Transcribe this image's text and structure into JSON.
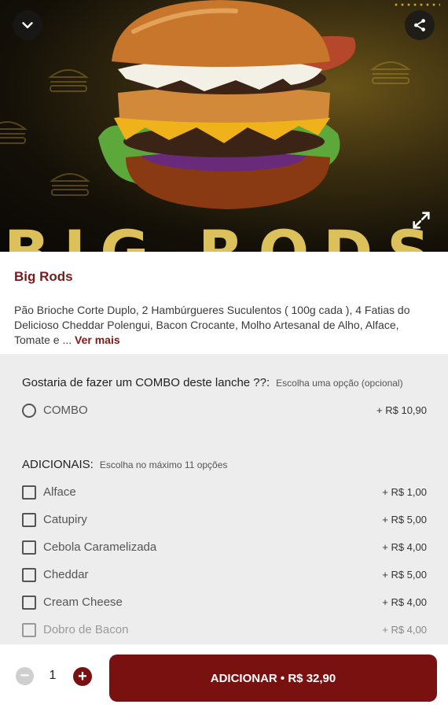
{
  "product": {
    "name": "Big Rods",
    "description": "Pão Brioche Corte Duplo, 2 Hambúrgueres Suculentos ( 100g cada ), 4 Fatias do Delicioso Cheddar Polengui, Bacon Crocante, Molho Artesanal de Alho, Alface, Tomate e ...",
    "read_more": "Ver mais",
    "hero_text": "BIG RODS"
  },
  "icons": {
    "back": "chevron-down-icon",
    "share": "share-icon",
    "expand": "expand-icon"
  },
  "combo": {
    "title": "Gostaria de fazer um COMBO deste lanche ??:",
    "hint": "Escolha uma opção (opcional)",
    "options": [
      {
        "label": "COMBO",
        "price": "+ R$ 10,90"
      }
    ]
  },
  "adicionais": {
    "title": "ADICIONAIS:",
    "hint": "Escolha no máximo 11 opções",
    "options": [
      {
        "label": "Alface",
        "price": "+ R$ 1,00"
      },
      {
        "label": "Catupiry",
        "price": "+ R$ 5,00"
      },
      {
        "label": "Cebola Caramelizada",
        "price": "+ R$ 4,00"
      },
      {
        "label": "Cheddar",
        "price": "+ R$ 5,00"
      },
      {
        "label": "Cream Cheese",
        "price": "+ R$ 4,00"
      },
      {
        "label": "Dobro de Bacon",
        "price": "+ R$ 4,00"
      }
    ]
  },
  "cart": {
    "minus": "−",
    "quantity": "1",
    "plus": "+",
    "add_label": "ADICIONAR • R$ 32,90"
  },
  "colors": {
    "brand": "#7a1111",
    "title": "#7a1b1b",
    "hero_text": "#dcc15a"
  }
}
